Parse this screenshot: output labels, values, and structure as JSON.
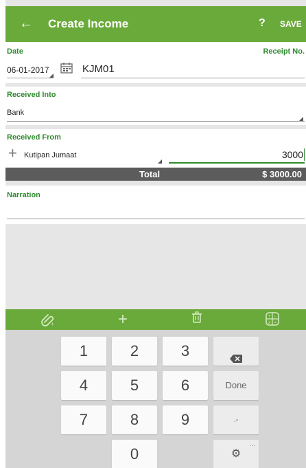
{
  "header": {
    "back_icon": "arrow-left-icon",
    "title": "Create Income",
    "help": "?",
    "save": "SAVE",
    "color": "#6aaa3a"
  },
  "date_section": {
    "date_label": "Date",
    "date_value": "06-01-2017",
    "calendar_icon": "calendar-icon",
    "receipt_label": "Receipt No.",
    "receipt_value": "KJM01"
  },
  "received_into": {
    "label": "Received Into",
    "value": "Bank"
  },
  "received_from": {
    "label": "Received From",
    "add_icon": "plus-icon",
    "account": "Kutipan Jumaat",
    "amount": "3000"
  },
  "total": {
    "label": "Total",
    "value": "$ 3000.00"
  },
  "narration": {
    "label": "Narration",
    "value": ""
  },
  "toolbar": {
    "items": [
      "attach-icon",
      "plus-icon",
      "trash-icon",
      "calculator-icon"
    ]
  },
  "keypad": {
    "keys": [
      "1",
      "2",
      "3",
      "4",
      "5",
      "6",
      "7",
      "8",
      "9",
      "0"
    ],
    "backspace_icon": "backspace-icon",
    "done": "Done",
    "dot_minus": ".-",
    "settings_icon": "gear-icon",
    "more": "..."
  }
}
